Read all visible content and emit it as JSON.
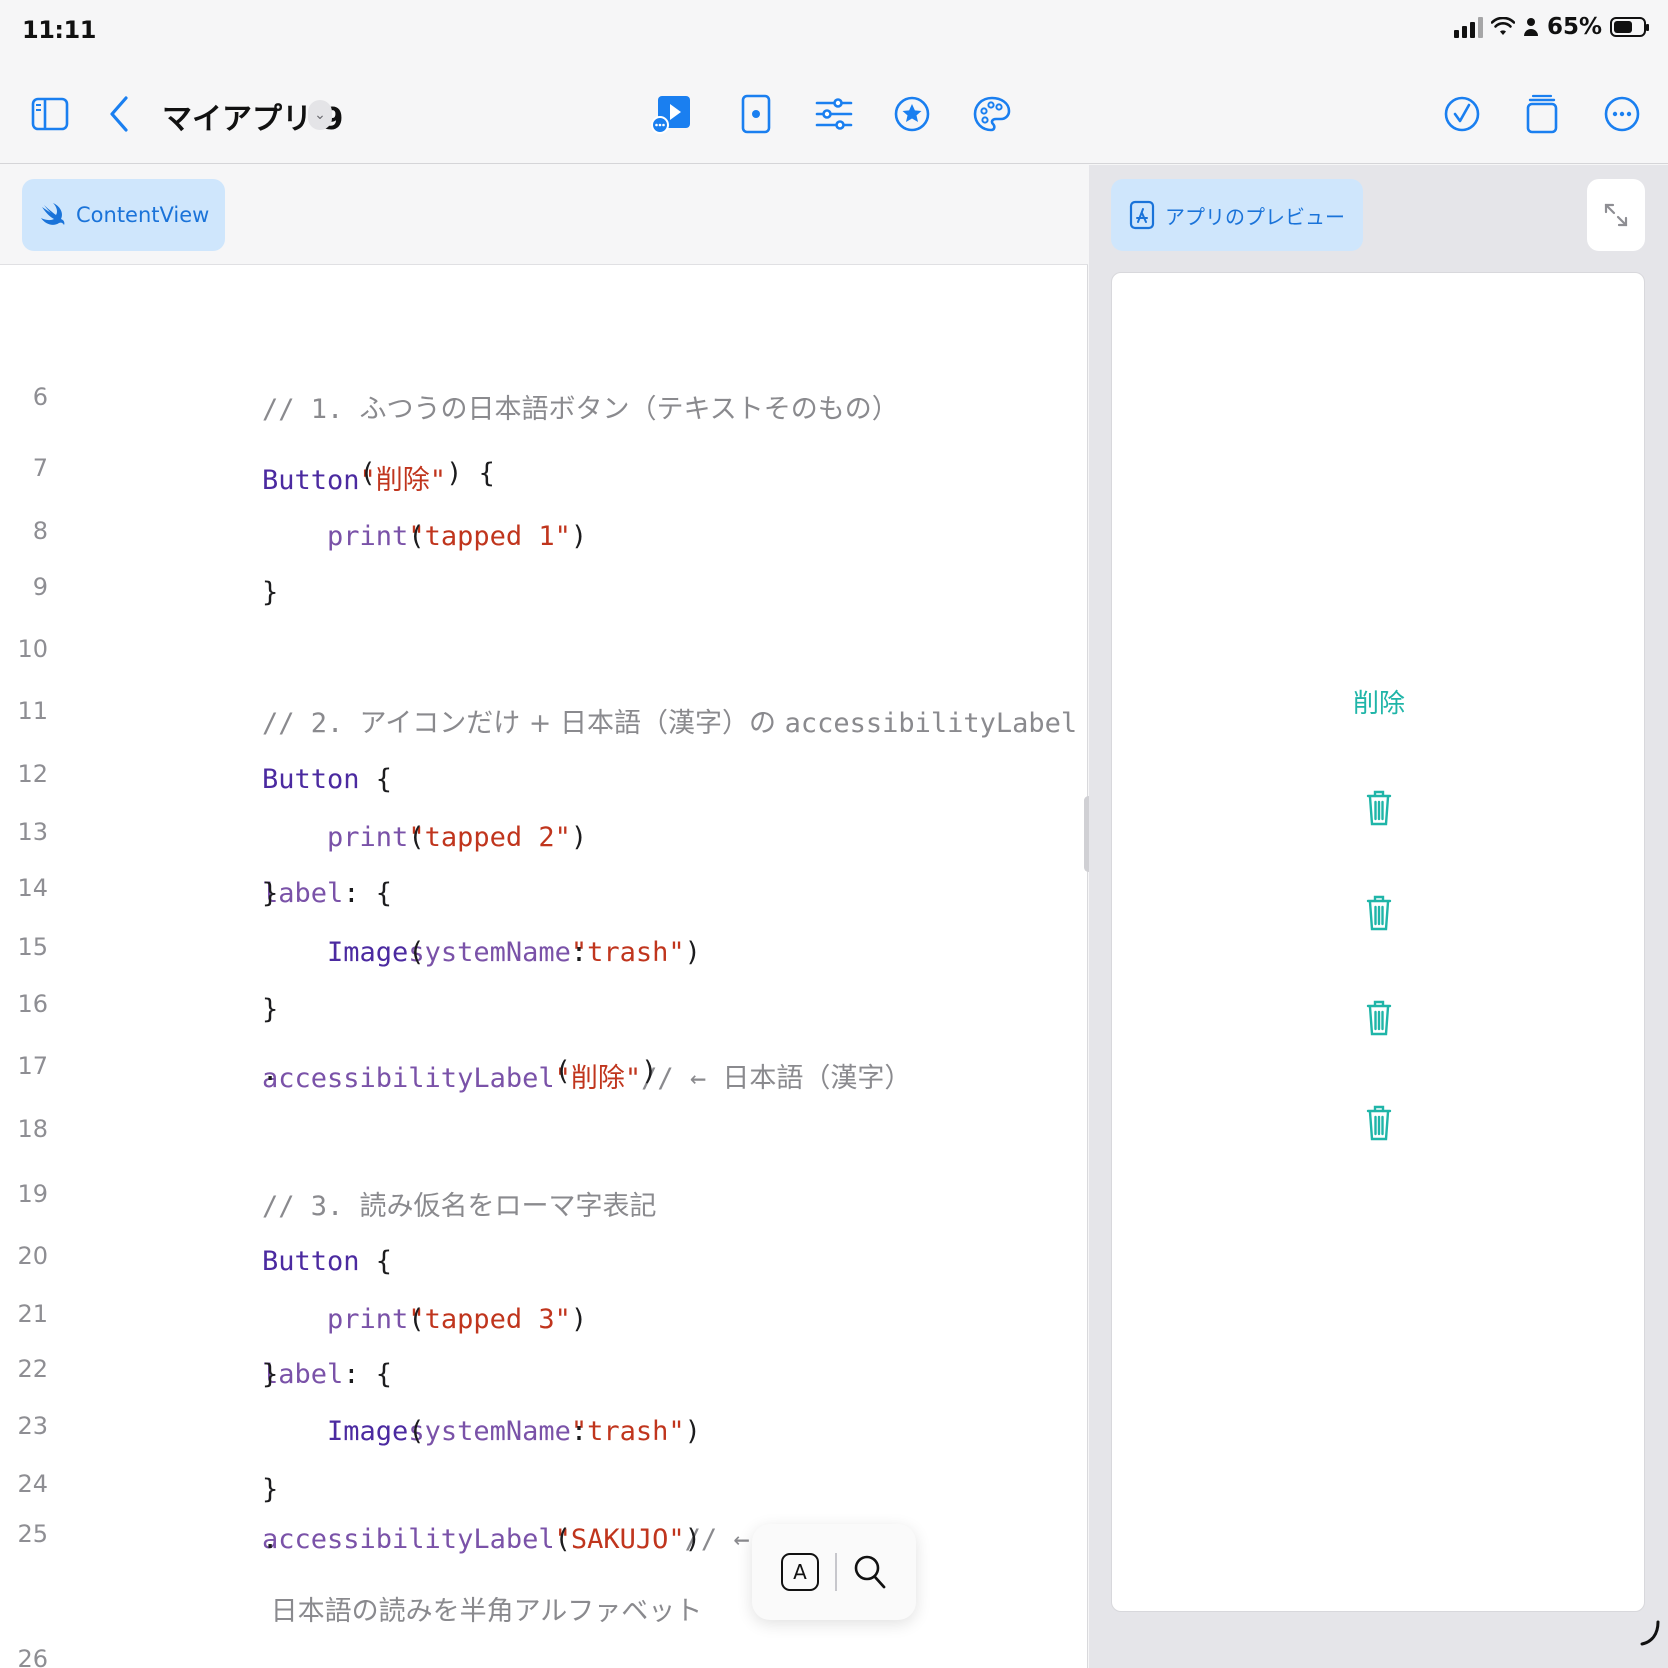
{
  "status": {
    "time": "11:11",
    "battery": "65%"
  },
  "toolbar": {
    "title": "マイアプリ 9",
    "icons": [
      "sidebar-icon",
      "back-chevron-icon",
      "run-preview-icon",
      "device-icon",
      "settings-sliders-icon",
      "star-icon",
      "palette-icon",
      "checkmark-icon",
      "copy-icon",
      "more-icon"
    ]
  },
  "editor": {
    "tab": "ContentView",
    "lines": [
      {
        "n": "6",
        "parts": [
          {
            "c": "cm",
            "t": "// 1. "
          },
          {
            "c": "cmt-jp",
            "t": "ふつうの日本語ボタン（テキストそのもの）"
          }
        ]
      },
      {
        "n": "7",
        "parts": [
          {
            "c": "kw",
            "t": "Button"
          },
          {
            "c": "tx",
            "t": "("
          },
          {
            "c": "str",
            "t": "\"削除\""
          },
          {
            "c": "tx",
            "t": ") {"
          }
        ]
      },
      {
        "n": "8",
        "parts": [
          {
            "c": "fn",
            "t": "    print"
          },
          {
            "c": "tx",
            "t": "("
          },
          {
            "c": "str",
            "t": "\"tapped 1\""
          },
          {
            "c": "tx",
            "t": ")"
          }
        ]
      },
      {
        "n": "9",
        "parts": [
          {
            "c": "tx",
            "t": "}"
          }
        ]
      },
      {
        "n": "10",
        "parts": []
      },
      {
        "n": "11",
        "parts": [
          {
            "c": "cm",
            "t": "// 2. "
          },
          {
            "c": "cmt-jp",
            "t": "アイコンだけ + 日本語（漢字）の "
          },
          {
            "c": "cm",
            "t": "accessibilityLabel"
          }
        ]
      },
      {
        "n": "12",
        "parts": [
          {
            "c": "kw",
            "t": "Button"
          },
          {
            "c": "tx",
            "t": " {"
          }
        ]
      },
      {
        "n": "13",
        "parts": [
          {
            "c": "fn",
            "t": "    print"
          },
          {
            "c": "tx",
            "t": "("
          },
          {
            "c": "str",
            "t": "\"tapped 2\""
          },
          {
            "c": "tx",
            "t": ")"
          }
        ]
      },
      {
        "n": "14",
        "parts": [
          {
            "c": "tx",
            "t": "} "
          },
          {
            "c": "fn",
            "t": "label"
          },
          {
            "c": "tx",
            "t": ": {"
          }
        ]
      },
      {
        "n": "15",
        "parts": [
          {
            "c": "kw",
            "t": "    Image"
          },
          {
            "c": "tx",
            "t": "("
          },
          {
            "c": "fn",
            "t": "systemName"
          },
          {
            "c": "tx",
            "t": ": "
          },
          {
            "c": "str",
            "t": "\"trash\""
          },
          {
            "c": "tx",
            "t": ")"
          }
        ]
      },
      {
        "n": "16",
        "parts": [
          {
            "c": "tx",
            "t": "}"
          }
        ]
      },
      {
        "n": "17",
        "parts": [
          {
            "c": "tx",
            "t": "."
          },
          {
            "c": "fn",
            "t": "accessibilityLabel"
          },
          {
            "c": "tx",
            "t": "("
          },
          {
            "c": "str",
            "t": "\"削除\""
          },
          {
            "c": "tx",
            "t": ")   "
          },
          {
            "c": "cm",
            "t": "// ← "
          },
          {
            "c": "cmt-jp",
            "t": "日本語（漢字）"
          }
        ]
      },
      {
        "n": "18",
        "parts": []
      },
      {
        "n": "19",
        "parts": [
          {
            "c": "cm",
            "t": "// 3. "
          },
          {
            "c": "cmt-jp",
            "t": "読み仮名をローマ字表記"
          }
        ]
      },
      {
        "n": "20",
        "parts": [
          {
            "c": "kw",
            "t": "Button"
          },
          {
            "c": "tx",
            "t": " {"
          }
        ]
      },
      {
        "n": "21",
        "parts": [
          {
            "c": "fn",
            "t": "    print"
          },
          {
            "c": "tx",
            "t": "("
          },
          {
            "c": "str",
            "t": "\"tapped 3\""
          },
          {
            "c": "tx",
            "t": ")"
          }
        ]
      },
      {
        "n": "22",
        "parts": [
          {
            "c": "tx",
            "t": "} "
          },
          {
            "c": "fn",
            "t": "label"
          },
          {
            "c": "tx",
            "t": ": {"
          }
        ]
      },
      {
        "n": "23",
        "parts": [
          {
            "c": "kw",
            "t": "    Image"
          },
          {
            "c": "tx",
            "t": "("
          },
          {
            "c": "fn",
            "t": "systemName"
          },
          {
            "c": "tx",
            "t": ": "
          },
          {
            "c": "str",
            "t": "\"trash\""
          },
          {
            "c": "tx",
            "t": ")"
          }
        ]
      },
      {
        "n": "24",
        "parts": [
          {
            "c": "tx",
            "t": "}"
          }
        ]
      },
      {
        "n": "25",
        "parts": [
          {
            "c": "tx",
            "t": "."
          },
          {
            "c": "fn",
            "t": "accessibilityLabel"
          },
          {
            "c": "tx",
            "t": "("
          },
          {
            "c": "str",
            "t": "\"SAKUJO\""
          },
          {
            "c": "tx",
            "t": ") "
          },
          {
            "c": "cm",
            "t": "// ←"
          }
        ]
      },
      {
        "n": "",
        "parts": [
          {
            "c": "cmt-jp",
            "t": " 日本語の読みを半角アルファベット"
          }
        ]
      },
      {
        "n": "26",
        "parts": []
      }
    ]
  },
  "keyboard_popup": {
    "key_label": "A"
  },
  "preview": {
    "tab": "アプリのプレビュー",
    "button_text": "削除",
    "accent": "#1fb5a8",
    "trash_icon_count": 4
  },
  "colors": {
    "accent": "#1a73d9",
    "tab_bg": "#cfe6fc"
  }
}
